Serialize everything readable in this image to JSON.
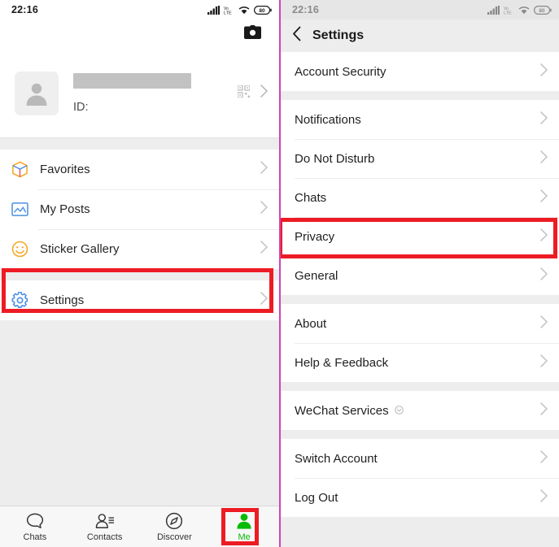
{
  "status_bar": {
    "time": "22:16",
    "network_label": "VoLTE",
    "battery_level": "80",
    "icons": [
      "signal-bars-icon",
      "volte-icon",
      "wifi-icon",
      "battery-icon"
    ]
  },
  "left_panel": {
    "camera_icon": "camera-icon",
    "profile": {
      "avatar": "default-avatar-icon",
      "name": "",
      "id_label": "ID:",
      "qr_icon": "qr-code-icon",
      "chevron": "chevron-right-icon"
    },
    "menu_items": [
      {
        "label": "Favorites",
        "icon": "favorites-box-icon"
      },
      {
        "label": "My Posts",
        "icon": "my-posts-photo-icon"
      },
      {
        "label": "Sticker Gallery",
        "icon": "sticker-smiley-icon"
      }
    ],
    "settings_item": {
      "label": "Settings",
      "icon": "settings-gear-icon"
    },
    "tabs": [
      {
        "label": "Chats",
        "icon": "chat-bubble-icon",
        "active": false
      },
      {
        "label": "Contacts",
        "icon": "contacts-icon",
        "active": false
      },
      {
        "label": "Discover",
        "icon": "compass-icon",
        "active": false
      },
      {
        "label": "Me",
        "icon": "person-icon",
        "active": true
      }
    ]
  },
  "right_panel": {
    "navbar": {
      "back_icon": "back-chevron-icon",
      "title": "Settings"
    },
    "groups": [
      {
        "items": [
          {
            "label": "Account Security"
          }
        ]
      },
      {
        "items": [
          {
            "label": "Notifications"
          },
          {
            "label": "Do Not Disturb"
          },
          {
            "label": "Chats"
          },
          {
            "label": "Privacy"
          },
          {
            "label": "General"
          }
        ]
      },
      {
        "items": [
          {
            "label": "About"
          },
          {
            "label": "Help & Feedback"
          }
        ]
      },
      {
        "items": [
          {
            "label": "WeChat Services",
            "badge_icon": "service-badge-icon"
          }
        ]
      },
      {
        "items": [
          {
            "label": "Switch Account"
          },
          {
            "label": "Log Out"
          }
        ]
      }
    ]
  },
  "annotations": {
    "highlight_color": "#ed1c24",
    "highlighted_elements": [
      "Settings",
      "Me",
      "Privacy"
    ]
  },
  "colors": {
    "accent_green": "#09bb07",
    "highlight_red": "#ed1c24",
    "background_gray": "#ededed",
    "divider_magenta": "#cf43b8"
  }
}
